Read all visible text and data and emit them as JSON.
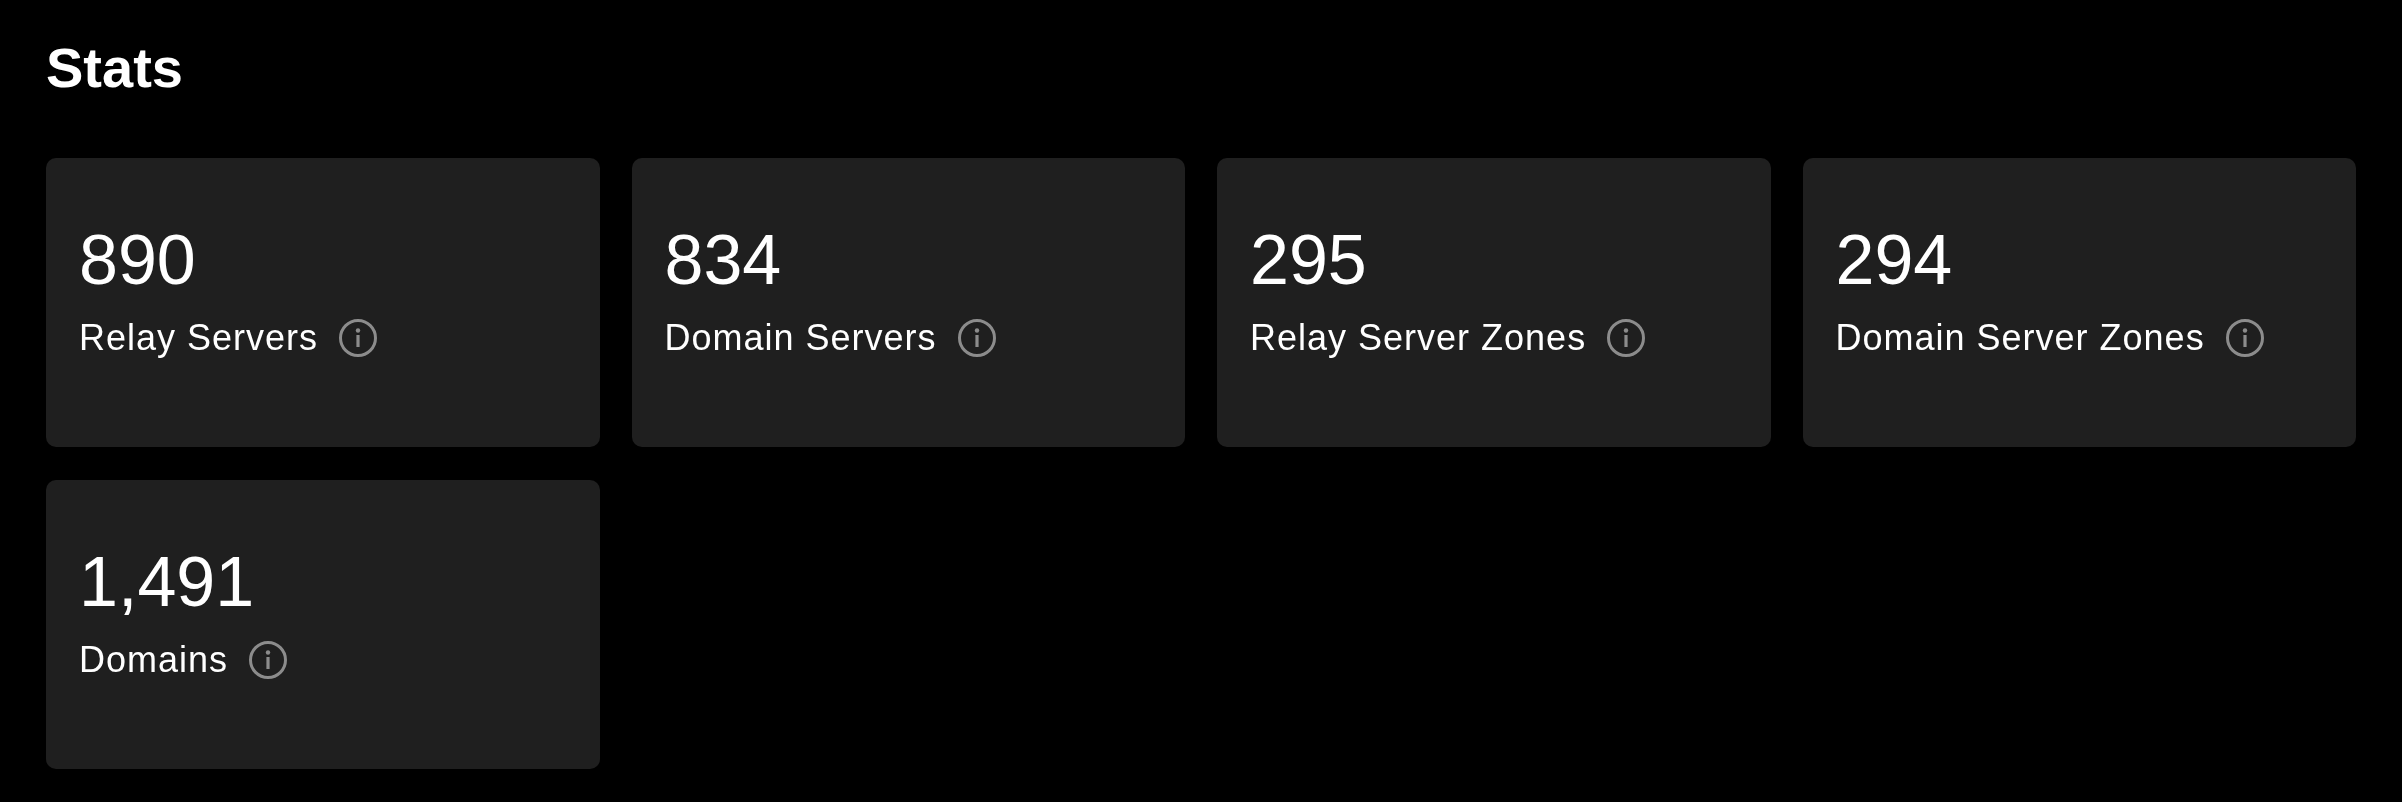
{
  "title": "Stats",
  "stats": [
    {
      "value": "890",
      "label": "Relay Servers"
    },
    {
      "value": "834",
      "label": "Domain Servers"
    },
    {
      "value": "295",
      "label": "Relay Server Zones"
    },
    {
      "value": "294",
      "label": "Domain Server Zones"
    },
    {
      "value": "1,491",
      "label": "Domains"
    }
  ]
}
